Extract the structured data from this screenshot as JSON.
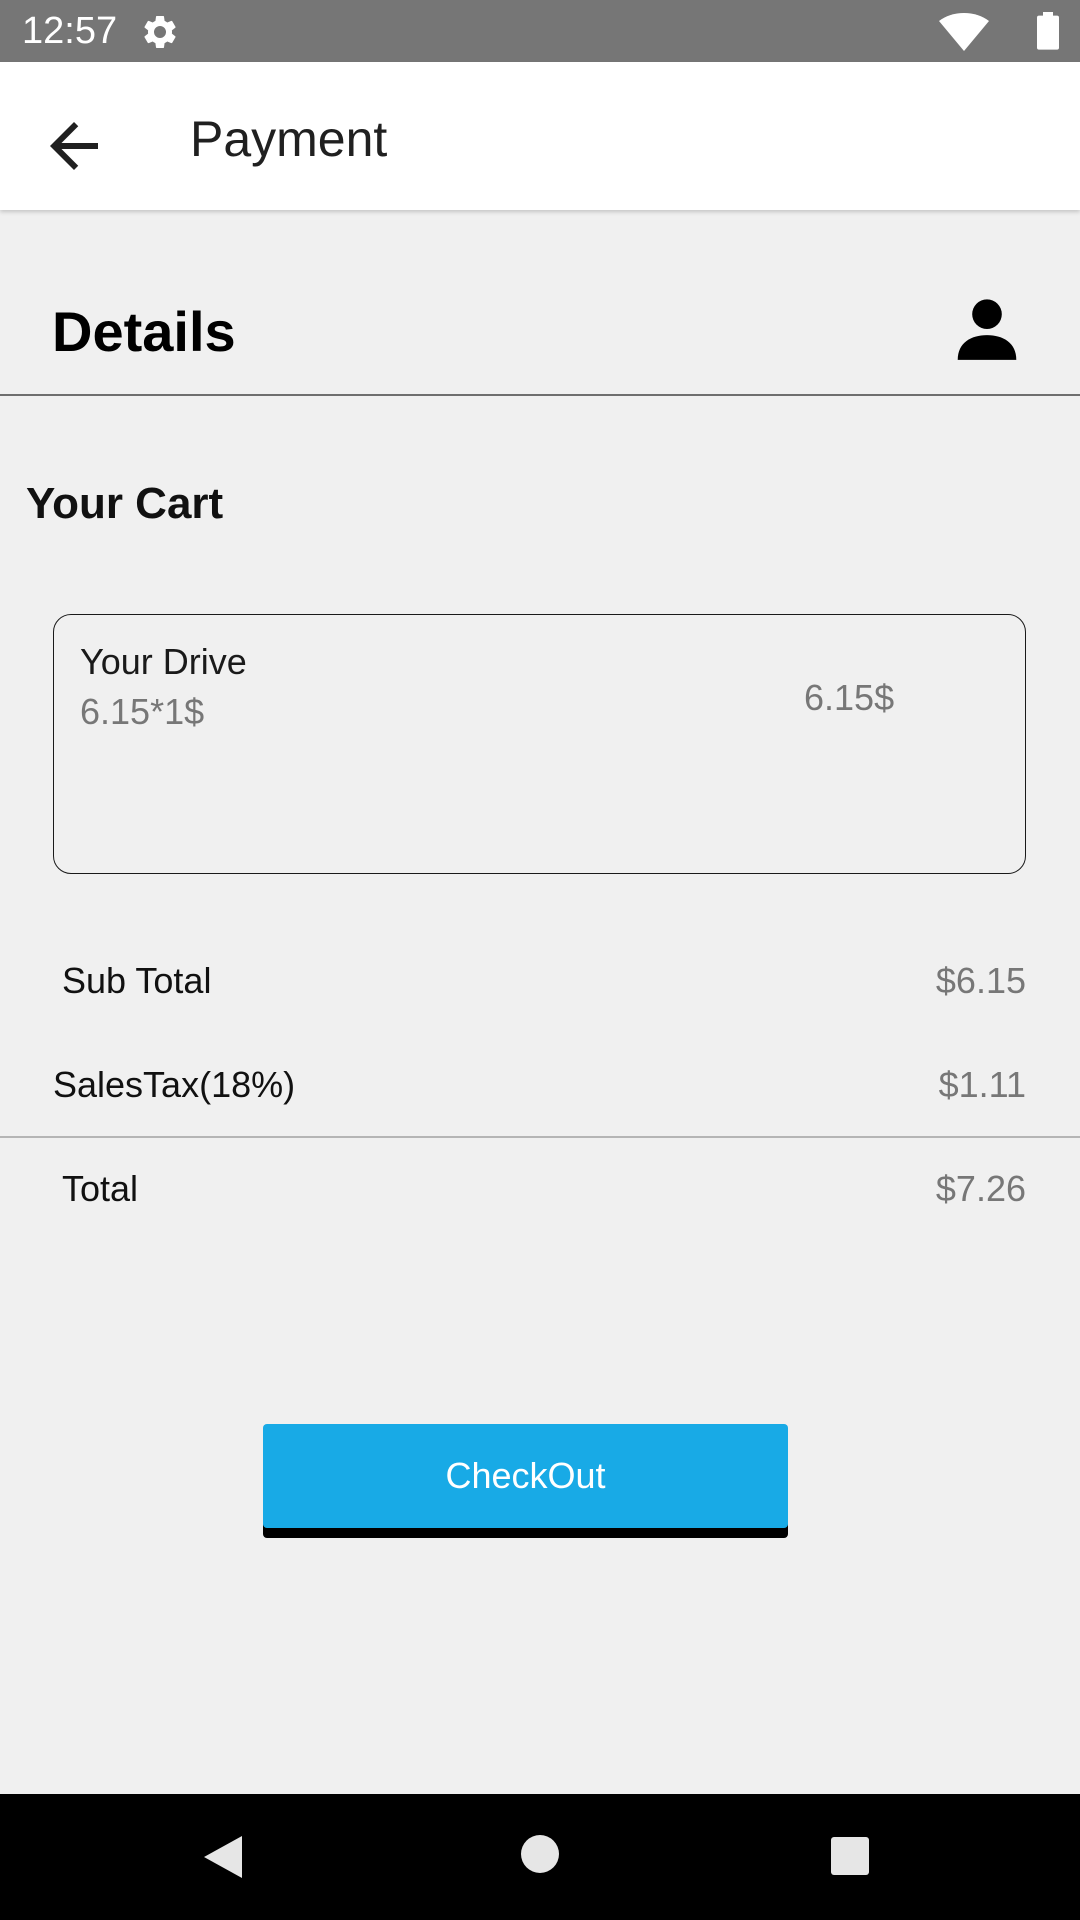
{
  "status_bar": {
    "time": "12:57",
    "icons": [
      "gear-icon",
      "wifi-icon",
      "battery-icon"
    ]
  },
  "app_bar": {
    "title": "Payment",
    "back_icon": "arrow-back-icon"
  },
  "details": {
    "title": "Details",
    "profile_icon": "person-icon"
  },
  "cart": {
    "title": "Your Cart",
    "item": {
      "name": "Your Drive",
      "detail": "6.15*1$",
      "price": "6.15$"
    }
  },
  "summary": {
    "subtotal_label": "Sub Total",
    "subtotal_value": "$6.15",
    "tax_label": "SalesTax(18%)",
    "tax_value": "$1.11",
    "total_label": "Total",
    "total_value": "$7.26"
  },
  "checkout": {
    "label": "CheckOut"
  },
  "colors": {
    "accent": "#18aae6",
    "status_bar": "#767676",
    "background": "#f0f0f0"
  },
  "nav_bar": {
    "icons": [
      "nav-back-icon",
      "nav-home-icon",
      "nav-recents-icon"
    ]
  }
}
